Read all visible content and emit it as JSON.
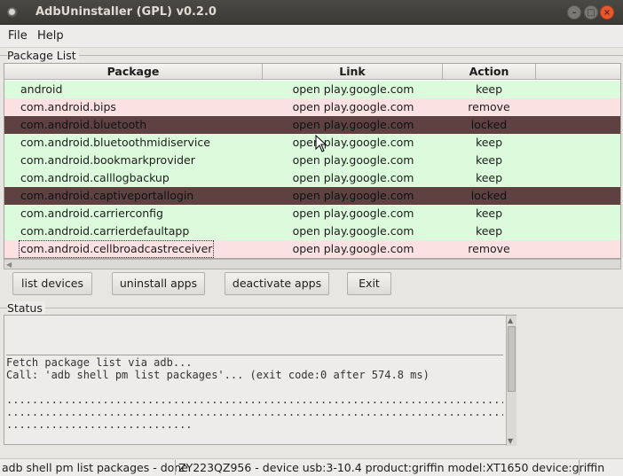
{
  "window": {
    "title": "AdbUninstaller (GPL) v0.2.0"
  },
  "menu": {
    "file": "File",
    "help": "Help"
  },
  "package_list": {
    "label": "Package List",
    "columns": [
      "Package",
      "Link",
      "Action"
    ],
    "rows": [
      {
        "package": "android",
        "link": "open play.google.com",
        "action": "keep"
      },
      {
        "package": "com.android.bips",
        "link": "open play.google.com",
        "action": "remove"
      },
      {
        "package": "com.android.bluetooth",
        "link": "open play.google.com",
        "action": "locked"
      },
      {
        "package": "com.android.bluetoothmidiservice",
        "link": "open play.google.com",
        "action": "keep"
      },
      {
        "package": "com.android.bookmarkprovider",
        "link": "open play.google.com",
        "action": "keep"
      },
      {
        "package": "com.android.calllogbackup",
        "link": "open play.google.com",
        "action": "keep"
      },
      {
        "package": "com.android.captiveportallogin",
        "link": "open play.google.com",
        "action": "locked"
      },
      {
        "package": "com.android.carrierconfig",
        "link": "open play.google.com",
        "action": "keep"
      },
      {
        "package": "com.android.carrierdefaultapp",
        "link": "open play.google.com",
        "action": "keep"
      },
      {
        "package": "com.android.cellbroadcastreceiver",
        "link": "open play.google.com",
        "action": "remove"
      }
    ],
    "row_colors": {
      "keep": "#dcfadc",
      "remove": "#fbe1e1",
      "locked": "#5f4142"
    }
  },
  "buttons": {
    "list_devices": "list devices",
    "uninstall_apps": "uninstall apps",
    "deactivate_apps": "deactivate apps",
    "exit": "Exit"
  },
  "status": {
    "label": "Status",
    "lines": [
      "Fetch package list via adb...",
      "Call: 'adb shell pm list packages'... (exit code:0 after 574.8 ms)",
      "",
      "................................................................................",
      "................................................................................",
      "............................."
    ]
  },
  "statusbar": {
    "message": "adb shell pm list packages - done",
    "device": "ZY223QZ956 - device usb:3-10.4 product:griffin model:XT1650 device:griffin"
  }
}
